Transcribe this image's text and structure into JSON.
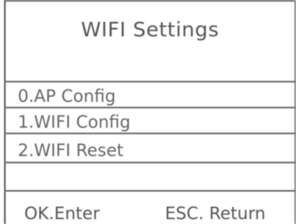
{
  "screen": {
    "title": "WIFI Settings"
  },
  "menu": {
    "items": [
      {
        "label": "0.AP Config"
      },
      {
        "label": "1.WIFI Config"
      },
      {
        "label": "2.WIFI Reset"
      }
    ]
  },
  "footer": {
    "ok_label": "OK.Enter",
    "esc_label": "ESC. Return"
  }
}
